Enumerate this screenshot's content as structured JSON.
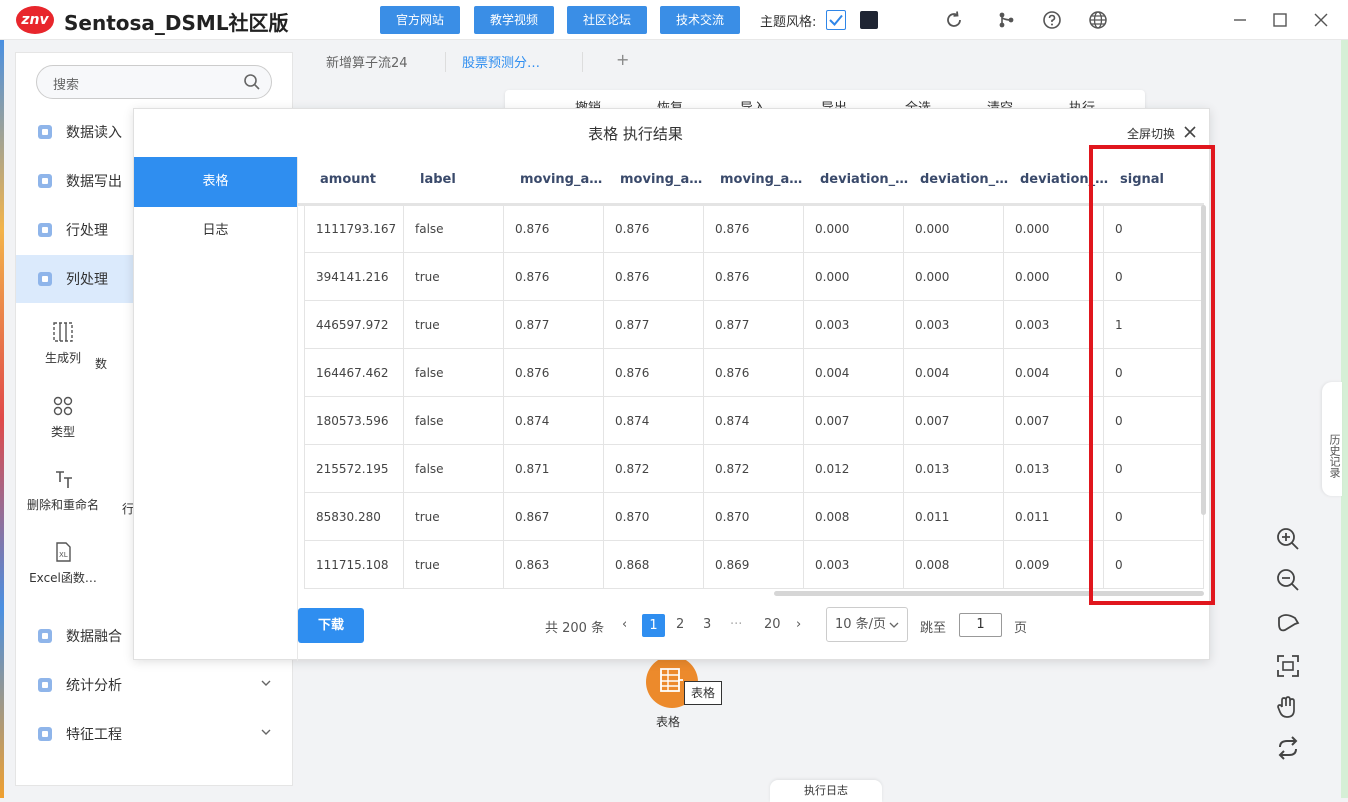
{
  "app": {
    "logo": "znv",
    "title": "Sentosa_DSML社区版"
  },
  "topbar": {
    "buttons": [
      "官方网站",
      "教学视频",
      "社区论坛",
      "技术交流"
    ],
    "theme_label": "主题风格:",
    "icons": [
      "refresh-icon",
      "share-icon",
      "help-icon",
      "globe-icon"
    ],
    "window": [
      "minimize",
      "maximize",
      "close"
    ]
  },
  "sidebar": {
    "search_placeholder": "搜索",
    "categories": [
      {
        "label": "数据读入"
      },
      {
        "label": "数据写出"
      },
      {
        "label": "行处理"
      },
      {
        "label": "列处理"
      }
    ],
    "sub_items": [
      "生成列",
      "数",
      "类型",
      "删除和重命名",
      "行",
      "Excel函数…"
    ],
    "categories_bottom": [
      {
        "label": "数据融合"
      },
      {
        "label": "统计分析"
      },
      {
        "label": "特征工程"
      }
    ]
  },
  "tabs": {
    "items": [
      "新增算子流24",
      "股票预测分…"
    ],
    "add": "+"
  },
  "toolbar": {
    "items": [
      "撤销",
      "恢复",
      "导入",
      "导出",
      "全选",
      "清空",
      "执行"
    ]
  },
  "modal": {
    "title": "表格 执行结果",
    "fullscreen": "全屏切换",
    "side_tabs": [
      "表格",
      "日志"
    ],
    "columns": [
      "amount",
      "label",
      "moving_a…",
      "moving_a…",
      "moving_a…",
      "deviation_…",
      "deviation_…",
      "deviation_…",
      "signal"
    ],
    "rows": [
      [
        "1111793.167",
        "false",
        "0.876",
        "0.876",
        "0.876",
        "0.000",
        "0.000",
        "0.000",
        "0"
      ],
      [
        "394141.216",
        "true",
        "0.876",
        "0.876",
        "0.876",
        "0.000",
        "0.000",
        "0.000",
        "0"
      ],
      [
        "446597.972",
        "true",
        "0.877",
        "0.877",
        "0.877",
        "0.003",
        "0.003",
        "0.003",
        "1"
      ],
      [
        "164467.462",
        "false",
        "0.876",
        "0.876",
        "0.876",
        "0.004",
        "0.004",
        "0.004",
        "0"
      ],
      [
        "180573.596",
        "false",
        "0.874",
        "0.874",
        "0.874",
        "0.007",
        "0.007",
        "0.007",
        "0"
      ],
      [
        "215572.195",
        "false",
        "0.871",
        "0.872",
        "0.872",
        "0.012",
        "0.013",
        "0.013",
        "0"
      ],
      [
        "85830.280",
        "true",
        "0.867",
        "0.870",
        "0.870",
        "0.008",
        "0.011",
        "0.011",
        "0"
      ],
      [
        "111715.108",
        "true",
        "0.863",
        "0.868",
        "0.869",
        "0.003",
        "0.008",
        "0.009",
        "0"
      ]
    ],
    "download": "下载",
    "pagination": {
      "total": "共 200 条",
      "prev": "‹",
      "pages": [
        "1",
        "2",
        "3",
        "···",
        "20"
      ],
      "next": "›",
      "page_size": "10 条/页",
      "jump_label": "跳至",
      "jump_value": "1",
      "page_suffix": "页"
    }
  },
  "node": {
    "tooltip": "表格",
    "label": "表格"
  },
  "side_panels": {
    "history": "历史记录",
    "log": "执行日志"
  },
  "colors": {
    "accent": "#2f8ef0",
    "highlight": "#e0161d",
    "node": "#ec8a2c"
  }
}
